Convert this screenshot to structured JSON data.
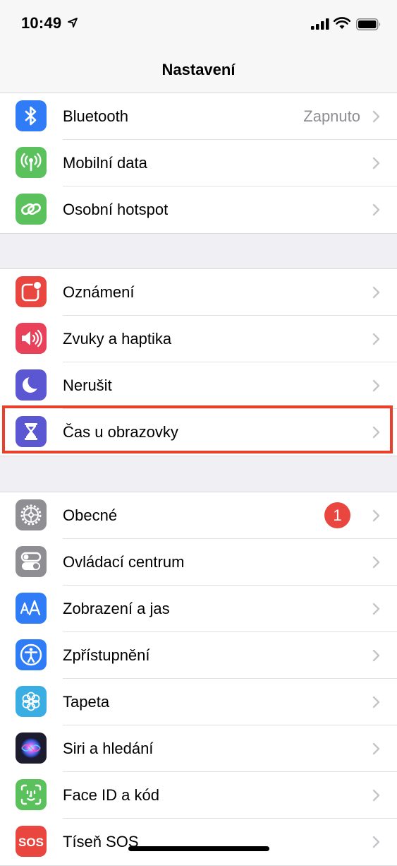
{
  "status_bar": {
    "time": "10:49"
  },
  "nav": {
    "title": "Nastavení"
  },
  "groups": [
    {
      "items": [
        {
          "label": "Bluetooth",
          "value": "Zapnuto",
          "icon": "bluetooth-icon",
          "color": "#2f7cf6"
        },
        {
          "label": "Mobilní data",
          "icon": "antenna-icon",
          "color": "#5ac15d"
        },
        {
          "label": "Osobní hotspot",
          "icon": "hotspot-icon",
          "color": "#5ac15d"
        }
      ]
    },
    {
      "items": [
        {
          "label": "Oznámení",
          "icon": "notifications-icon",
          "color": "#e8463e"
        },
        {
          "label": "Zvuky a haptika",
          "icon": "speaker-icon",
          "color": "#e9415a"
        },
        {
          "label": "Nerušit",
          "icon": "moon-icon",
          "color": "#5b56d2"
        },
        {
          "label": "Čas u obrazovky",
          "icon": "hourglass-icon",
          "color": "#5b56d2"
        }
      ]
    },
    {
      "items": [
        {
          "label": "Obecné",
          "badge": "1",
          "icon": "gear-icon",
          "color": "#8e8e93"
        },
        {
          "label": "Ovládací centrum",
          "icon": "toggles-icon",
          "color": "#8e8e93"
        },
        {
          "label": "Zobrazení a jas",
          "icon": "text-size-icon",
          "color": "#2f7cf6"
        },
        {
          "label": "Zpřístupnění",
          "icon": "accessibility-icon",
          "color": "#2f7cf6"
        },
        {
          "label": "Tapeta",
          "icon": "flower-icon",
          "color": "#3aaee3"
        },
        {
          "label": "Siri a hledání",
          "icon": "siri-icon",
          "color": "#1c1c2e"
        },
        {
          "label": "Face ID a kód",
          "icon": "face-id-icon",
          "color": "#5ac15d"
        },
        {
          "label": "Tíseň SOS",
          "icon": "sos-icon",
          "icon_text": "SOS",
          "color": "#e8463e"
        }
      ]
    }
  ]
}
